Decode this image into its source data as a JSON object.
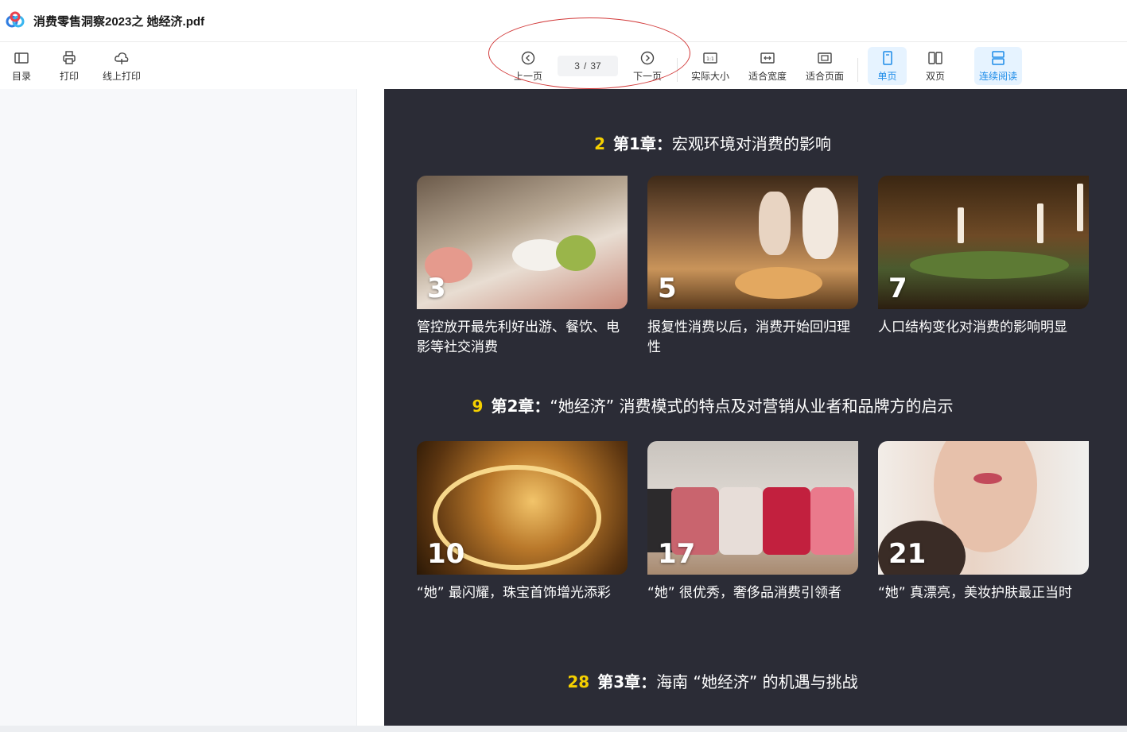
{
  "window": {
    "title": "消费零售洞察2023之 她经济.pdf",
    "logo_icon": "cloud-logo-icon"
  },
  "toolbar": {
    "toc_label": "目录",
    "print_label": "打印",
    "online_print_label": "线上打印",
    "prev_label": "上一页",
    "next_label": "下一页",
    "current_page": "3",
    "page_sep": "/",
    "total_pages": "37",
    "actual_size_label": "实际大小",
    "fit_width_label": "适合宽度",
    "fit_page_label": "适合页面",
    "single_page_label": "单页",
    "double_page_label": "双页",
    "continuous_label": "连续阅读",
    "accent_color": "#1c8be8"
  },
  "document": {
    "background_color": "#2b2c36",
    "highlight_color": "#f5d000",
    "chapters": [
      {
        "page": "2",
        "tag": "第1章：",
        "title": "宏观环境对消费的影响",
        "cards": [
          {
            "page": "3",
            "caption": "管控放开最先利好出游、餐饮、电影等社交消费"
          },
          {
            "page": "5",
            "caption": "报复性消费以后，消费开始回归理性"
          },
          {
            "page": "7",
            "caption": "人口结构变化对消费的影响明显"
          }
        ]
      },
      {
        "page": "9",
        "tag": "第2章：",
        "title": "“她经济” 消费模式的特点及对营销从业者和品牌方的启示",
        "cards": [
          {
            "page": "10",
            "caption": "“她” 最闪耀，珠宝首饰增光添彩"
          },
          {
            "page": "17",
            "caption": "“她” 很优秀，奢侈品消费引领者"
          },
          {
            "page": "21",
            "caption": "“她” 真漂亮，美妆护肤最正当时"
          }
        ]
      },
      {
        "page": "28",
        "tag": "第3章：",
        "title": "海南 “她经济” 的机遇与挑战",
        "cards": []
      }
    ]
  }
}
